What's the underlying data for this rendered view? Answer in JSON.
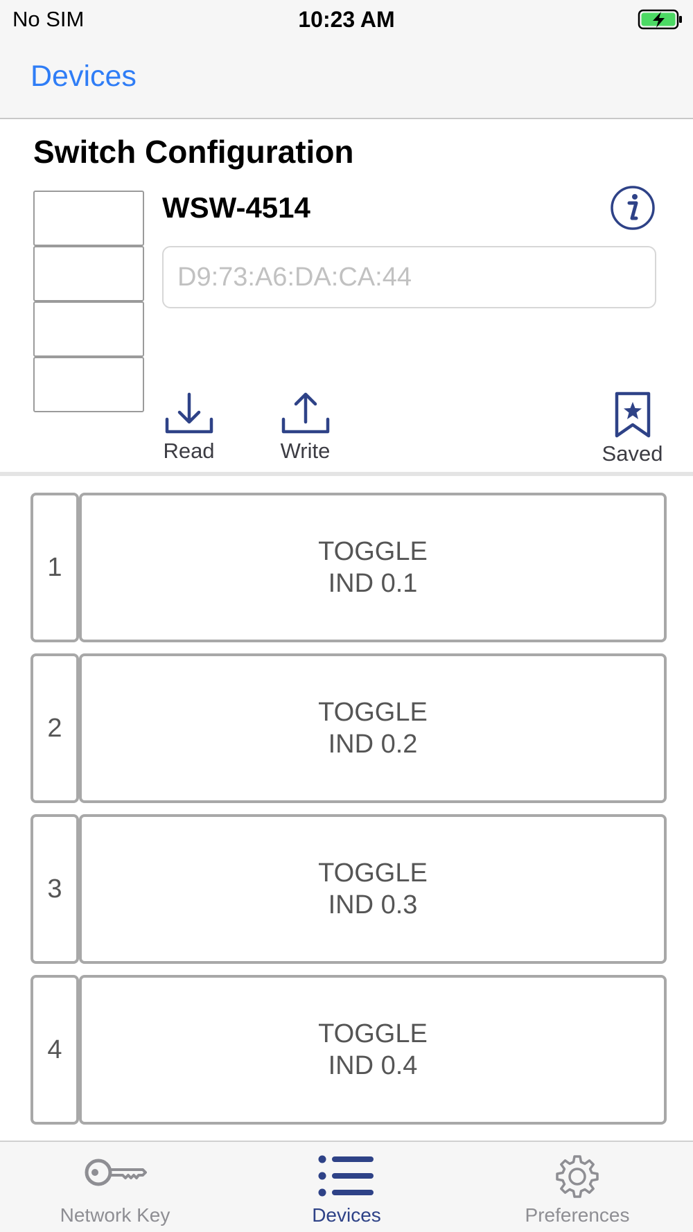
{
  "status_bar": {
    "carrier": "No SIM",
    "time": "10:23 AM",
    "battery_icon": "battery-charging-icon"
  },
  "nav": {
    "back_label": "Devices"
  },
  "header": {
    "title": "Switch Configuration",
    "device_name": "WSW-4514",
    "mac_placeholder": "D9:73:A6:DA:CA:44",
    "mac_value": "",
    "info_icon": "info-icon"
  },
  "actions": {
    "read_label": "Read",
    "write_label": "Write",
    "saved_label": "Saved"
  },
  "switches": [
    {
      "index": "1",
      "line1": "TOGGLE",
      "line2": "IND 0.1"
    },
    {
      "index": "2",
      "line1": "TOGGLE",
      "line2": "IND 0.2"
    },
    {
      "index": "3",
      "line1": "TOGGLE",
      "line2": "IND 0.3"
    },
    {
      "index": "4",
      "line1": "TOGGLE",
      "line2": "IND 0.4"
    }
  ],
  "tabs": [
    {
      "label": "Network Key",
      "icon": "key-icon",
      "active": false
    },
    {
      "label": "Devices",
      "icon": "list-icon",
      "active": true
    },
    {
      "label": "Preferences",
      "icon": "gear-icon",
      "active": false
    }
  ],
  "colors": {
    "accent_blue": "#2f7df6",
    "icon_navy": "#2e4287",
    "battery_green": "#4cd964",
    "border_gray": "#a8a8a8"
  }
}
